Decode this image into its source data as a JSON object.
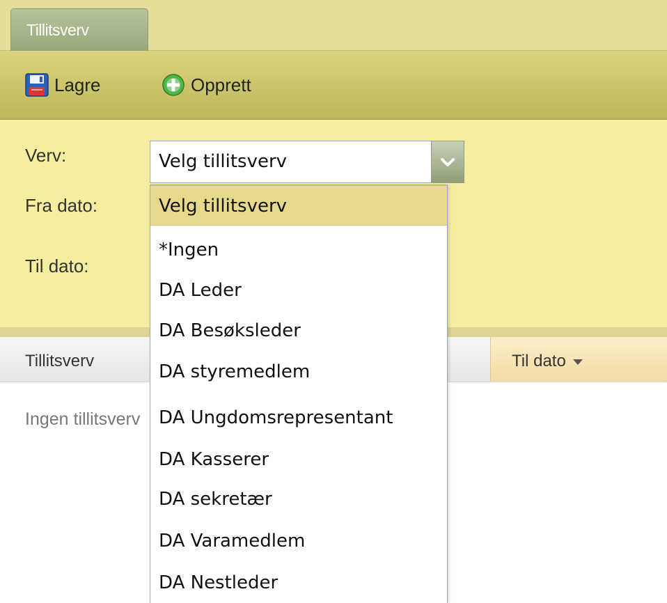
{
  "tabs": [
    {
      "label": "Tillitsverv",
      "active": true
    }
  ],
  "toolbar": {
    "save_label": "Lagre",
    "create_label": "Opprett"
  },
  "form": {
    "verv_label": "Verv:",
    "fra_dato_label": "Fra dato:",
    "til_dato_label": "Til dato:",
    "verv_value": "Velg tillitsverv"
  },
  "dropdown": {
    "open": true,
    "selected_index": 0,
    "items": [
      "Velg tillitsverv",
      "*Ingen",
      "DA Leder",
      "DA Besøksleder",
      "DA styremedlem",
      "DA Ungdomsrepresentant",
      "DA Kasserer",
      "DA sekretær",
      "DA Varamedlem",
      "DA Nestleder"
    ]
  },
  "grid": {
    "columns": [
      "Tillitsverv",
      "Til dato"
    ],
    "sorted_column": "Til dato",
    "sort_direction": "descending",
    "empty_text": "Ingen tillitsverv"
  },
  "icons": {
    "save": "floppy-disk-icon",
    "create": "plus-circle-icon",
    "combo_trigger": "chevron-down-icon",
    "sort": "sort-descending-icon"
  },
  "colors": {
    "tab_bar": "#e3de98",
    "toolbar": "#c9c26a",
    "form_background": "#f5ee9e",
    "tab_active": "#a5b589",
    "dropdown_selected": "#e6d98c",
    "sorted_header": "#f4dba4"
  }
}
